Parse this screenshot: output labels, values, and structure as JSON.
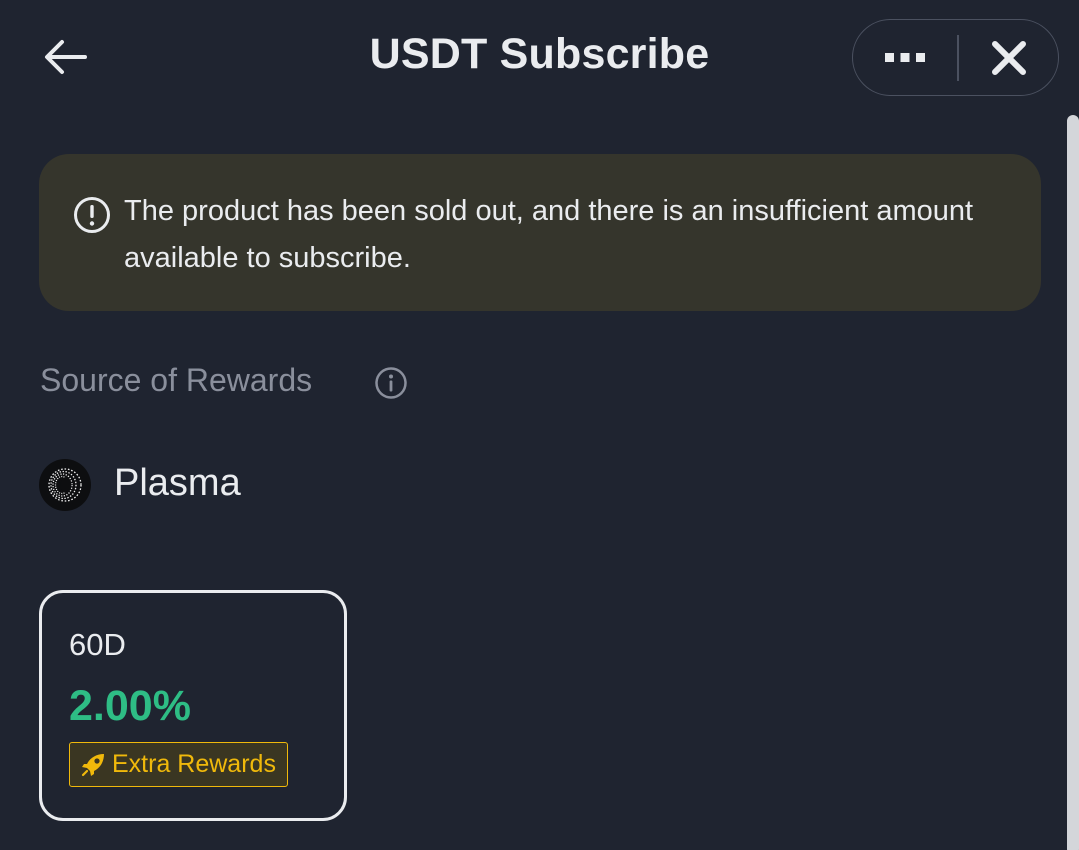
{
  "header": {
    "title": "USDT Subscribe",
    "back_icon": "arrow-left-icon",
    "more_icon": "more-dots-icon",
    "close_icon": "close-icon"
  },
  "warning": {
    "icon": "exclamation-circle-icon",
    "message": "The product has been sold out, and there is an insufficient amount available to subscribe."
  },
  "rewards_source": {
    "label": "Source of Rewards",
    "info_icon": "info-icon",
    "provider": {
      "logo": "plasma-logo",
      "name": "Plasma"
    }
  },
  "terms": [
    {
      "duration": "60D",
      "rate": "2.00%",
      "badge": {
        "icon": "rocket-icon",
        "label": "Extra Rewards"
      }
    }
  ],
  "colors": {
    "background": "#1f2430",
    "warning_background": "#35352c",
    "rate_green": "#2ebd85",
    "badge_yellow": "#f0b90b",
    "muted_text": "#8a8f9c"
  }
}
